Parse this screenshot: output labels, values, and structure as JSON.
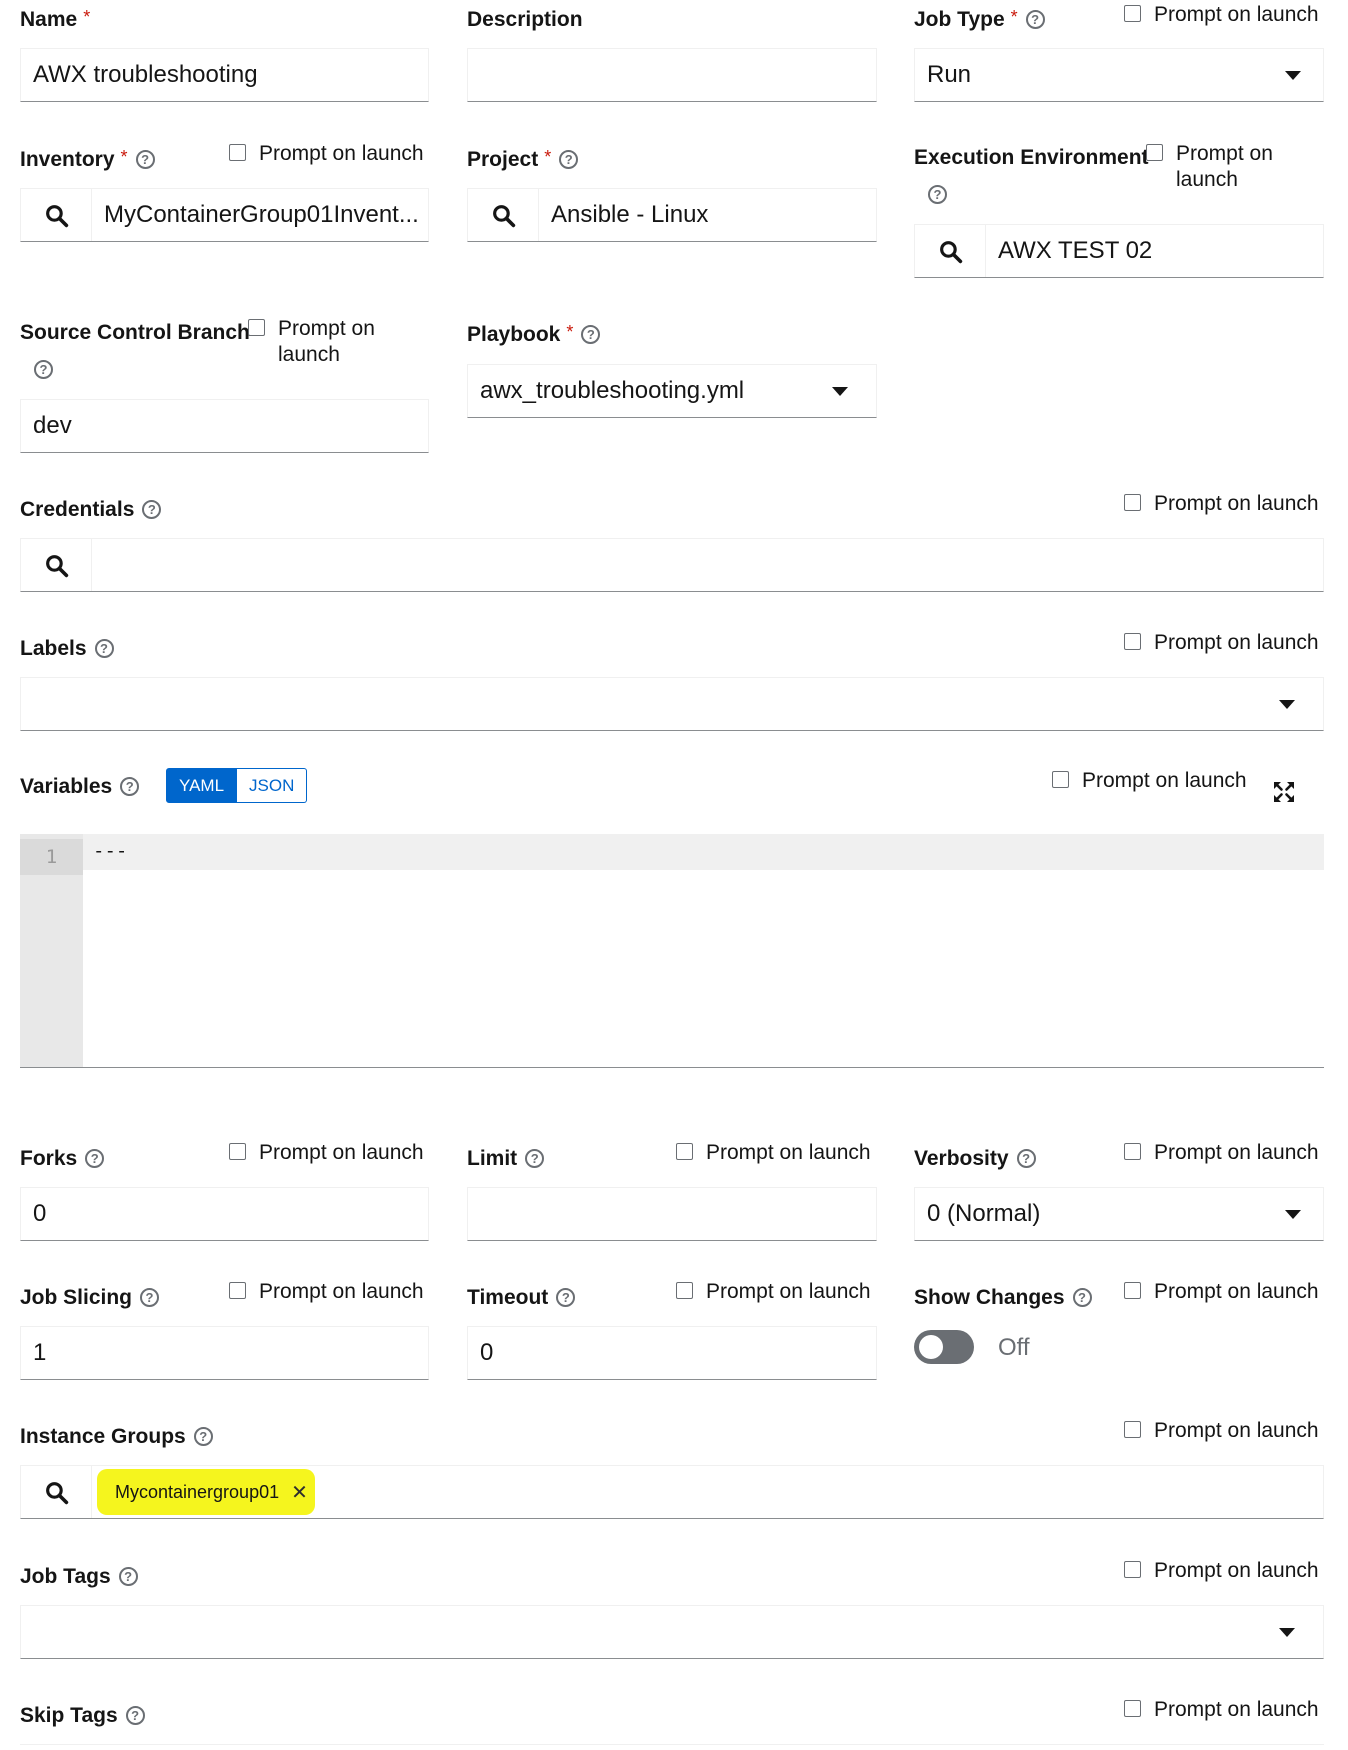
{
  "prompt_label": "Prompt on launch",
  "prompt_label_line1": "Prompt on",
  "prompt_label_line2": "launch",
  "colors": {
    "required": "#c9190b",
    "accent": "#0066cc",
    "highlight": "#f5f51e",
    "toggle_off": "#6a6e73"
  },
  "name": {
    "label": "Name",
    "value": "AWX troubleshooting"
  },
  "description": {
    "label": "Description",
    "value": ""
  },
  "job_type": {
    "label": "Job Type",
    "value": "Run"
  },
  "inventory": {
    "label": "Inventory",
    "value": "MyContainerGroup01Invent..."
  },
  "project": {
    "label": "Project",
    "value": "Ansible - Linux"
  },
  "execution_environment": {
    "label": "Execution Environment",
    "value": "AWX TEST 02"
  },
  "source_control_branch": {
    "label": "Source Control Branch",
    "value": "dev"
  },
  "playbook": {
    "label": "Playbook",
    "value": "awx_troubleshooting.yml"
  },
  "credentials": {
    "label": "Credentials",
    "value": ""
  },
  "labels": {
    "label": "Labels",
    "value": ""
  },
  "variables": {
    "label": "Variables",
    "mode_yaml": "YAML",
    "mode_json": "JSON",
    "line_number": "1",
    "code": "---"
  },
  "forks": {
    "label": "Forks",
    "value": "0"
  },
  "limit": {
    "label": "Limit",
    "value": ""
  },
  "verbosity": {
    "label": "Verbosity",
    "value": "0 (Normal)"
  },
  "job_slicing": {
    "label": "Job Slicing",
    "value": "1"
  },
  "timeout": {
    "label": "Timeout",
    "value": "0"
  },
  "show_changes": {
    "label": "Show Changes",
    "state": "Off"
  },
  "instance_groups": {
    "label": "Instance Groups",
    "chip": "Mycontainergroup01",
    "chip_remove": "✕"
  },
  "job_tags": {
    "label": "Job Tags",
    "value": ""
  },
  "skip_tags": {
    "label": "Skip Tags"
  }
}
